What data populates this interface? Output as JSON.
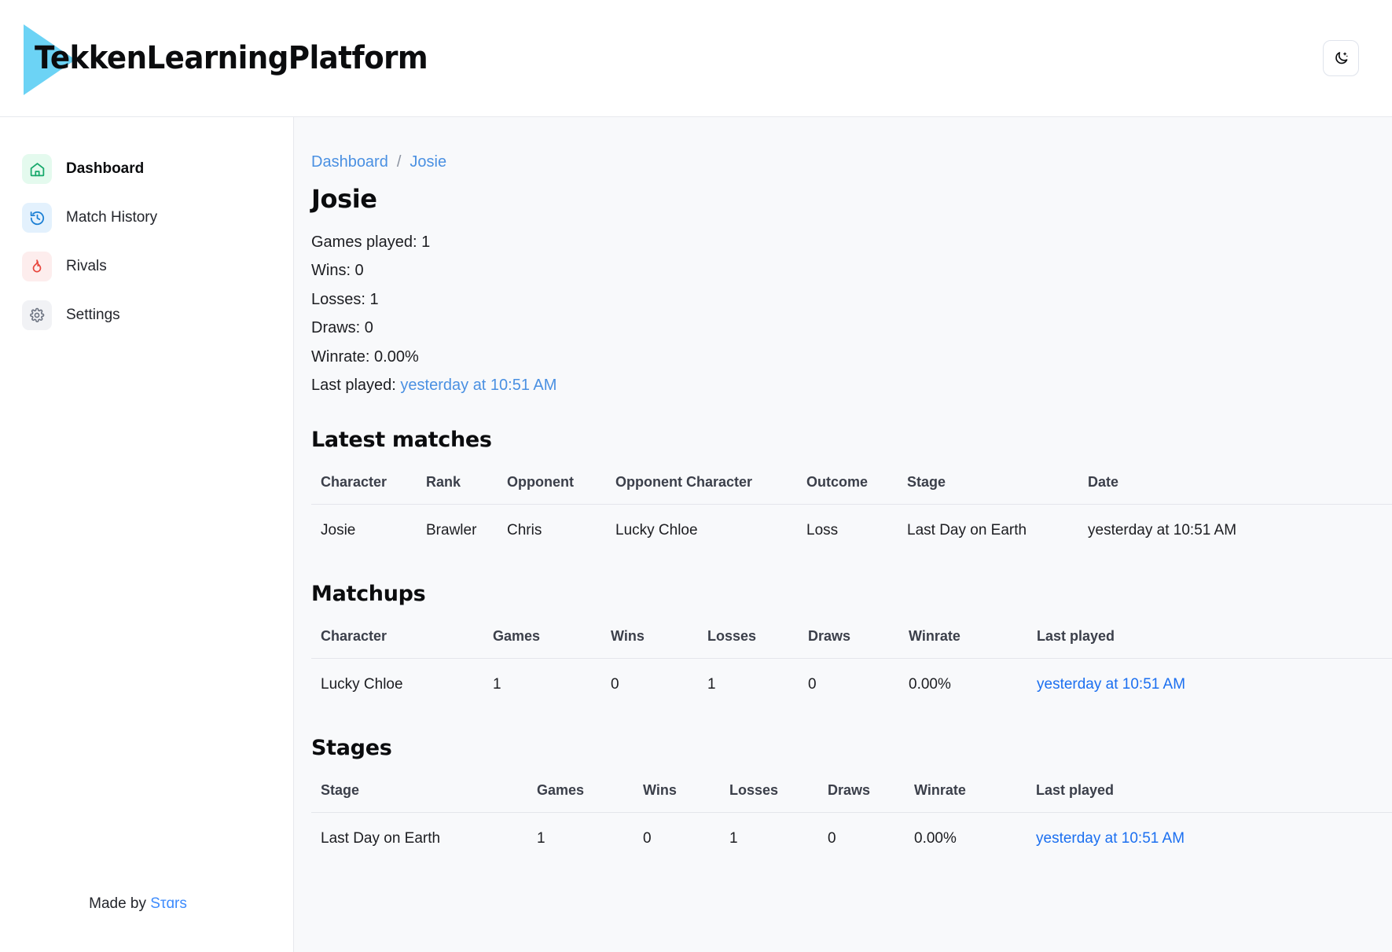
{
  "header": {
    "brand_name": "TekkenLearningPlatform",
    "theme_toggle_icon": "moon-stars-icon",
    "logo_color": "#6cd3f5"
  },
  "sidebar": {
    "items": [
      {
        "label": "Dashboard",
        "icon": "home-icon",
        "active": true,
        "chip_color": "#e4faee",
        "icon_color": "#16a86b"
      },
      {
        "label": "Match History",
        "icon": "history-clock-icon",
        "active": false,
        "chip_color": "#e3f1fd",
        "icon_color": "#1b7fd4"
      },
      {
        "label": "Rivals",
        "icon": "flame-icon",
        "active": false,
        "chip_color": "#fdeded",
        "icon_color": "#e8453c"
      },
      {
        "label": "Settings",
        "icon": "gear-icon",
        "active": false,
        "chip_color": "#f1f2f5",
        "icon_color": "#6b7280"
      }
    ],
    "footer": {
      "made_by_prefix": "Made by ",
      "author": "Sτɑrs"
    }
  },
  "main": {
    "breadcrumb": {
      "root": "Dashboard",
      "separator": "/",
      "current": "Josie"
    },
    "page_title": "Josie",
    "stats": {
      "games_played": "Games played: 1",
      "wins": "Wins: 0",
      "losses": "Losses: 1",
      "draws": "Draws: 0",
      "winrate": "Winrate: 0.00%",
      "last_played_label": "Last played: ",
      "last_played_value": "yesterday at 10:51 AM"
    },
    "latest_matches": {
      "title": "Latest matches",
      "columns": [
        "Character",
        "Rank",
        "Opponent",
        "Opponent Character",
        "Outcome",
        "Stage",
        "Date"
      ],
      "rows": [
        {
          "character": "Josie",
          "rank": "Brawler",
          "opponent": "Chris",
          "opponent_character": "Lucky Chloe",
          "outcome": "Loss",
          "outcome_color": "#e0453a",
          "stage": "Last Day on Earth",
          "date": "yesterday at 10:51 AM"
        }
      ]
    },
    "matchups": {
      "title": "Matchups",
      "columns": [
        "Character",
        "Games",
        "Wins",
        "Losses",
        "Draws",
        "Winrate",
        "Last played"
      ],
      "rows": [
        {
          "character": "Lucky Chloe",
          "games": "1",
          "wins": "0",
          "losses": "1",
          "draws": "0",
          "winrate": "0.00%",
          "last_played": "yesterday at 10:51 AM"
        }
      ]
    },
    "stages": {
      "title": "Stages",
      "columns": [
        "Stage",
        "Games",
        "Wins",
        "Losses",
        "Draws",
        "Winrate",
        "Last played"
      ],
      "rows": [
        {
          "stage": "Last Day on Earth",
          "games": "1",
          "wins": "0",
          "losses": "1",
          "draws": "0",
          "winrate": "0.00%",
          "last_played": "yesterday at 10:51 AM"
        }
      ]
    }
  }
}
